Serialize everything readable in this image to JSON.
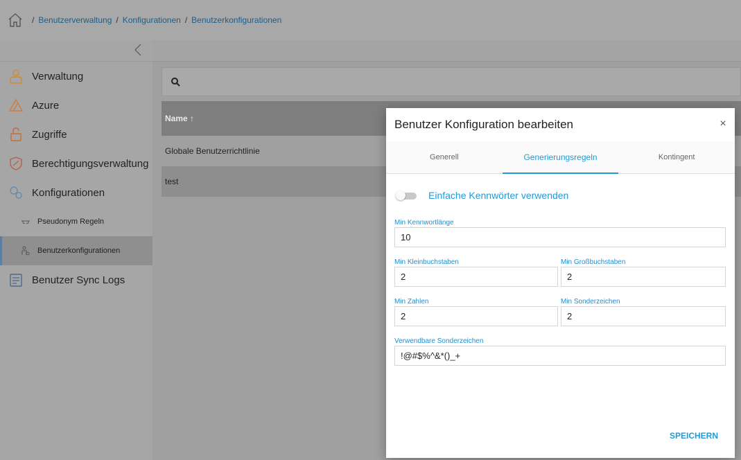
{
  "breadcrumb": {
    "items": [
      "Benutzerverwaltung",
      "Konfigurationen",
      "Benutzerkonfigurationen"
    ],
    "separator": "/"
  },
  "sidebar": {
    "items": [
      {
        "label": "Verwaltung",
        "icon": "admin-icon"
      },
      {
        "label": "Azure",
        "icon": "azure-icon"
      },
      {
        "label": "Zugriffe",
        "icon": "lock-icon"
      },
      {
        "label": "Berechtigungsverwaltung",
        "icon": "shield-icon"
      },
      {
        "label": "Konfigurationen",
        "icon": "gears-icon"
      }
    ],
    "sub_items": [
      {
        "label": "Pseudonym Regeln",
        "icon": "mask-icon"
      },
      {
        "label": "Benutzerkonfigurationen",
        "icon": "user-config-icon",
        "active": true
      }
    ],
    "bottom_item": {
      "label": "Benutzer Sync Logs",
      "icon": "log-icon"
    }
  },
  "table": {
    "header": "Name ↑",
    "rows": [
      "Globale Benutzerrichtlinie",
      "test"
    ]
  },
  "modal": {
    "title": "Benutzer Konfiguration bearbeiten",
    "close": "×",
    "tabs": [
      "Generell",
      "Generierungsregeln",
      "Kontingent"
    ],
    "active_tab": 1,
    "toggle_label": "Einfache Kennwörter verwenden",
    "toggle_on": false,
    "fields": {
      "min_length": {
        "label": "Min Kennwortlänge",
        "value": "10"
      },
      "min_lower": {
        "label": "Min Kleinbuchstaben",
        "value": "2"
      },
      "min_upper": {
        "label": "Min Großbuchstaben",
        "value": "2"
      },
      "min_numbers": {
        "label": "Min Zahlen",
        "value": "2"
      },
      "min_special": {
        "label": "Min Sonderzeichen",
        "value": "2"
      },
      "allowed_special": {
        "label": "Verwendbare Sonderzeichen",
        "value": "!@#$%^&*()_+"
      }
    },
    "save_label": "SPEICHERN"
  },
  "colors": {
    "accent": "#1e9bd7",
    "overlay": "#a0a0a0"
  }
}
